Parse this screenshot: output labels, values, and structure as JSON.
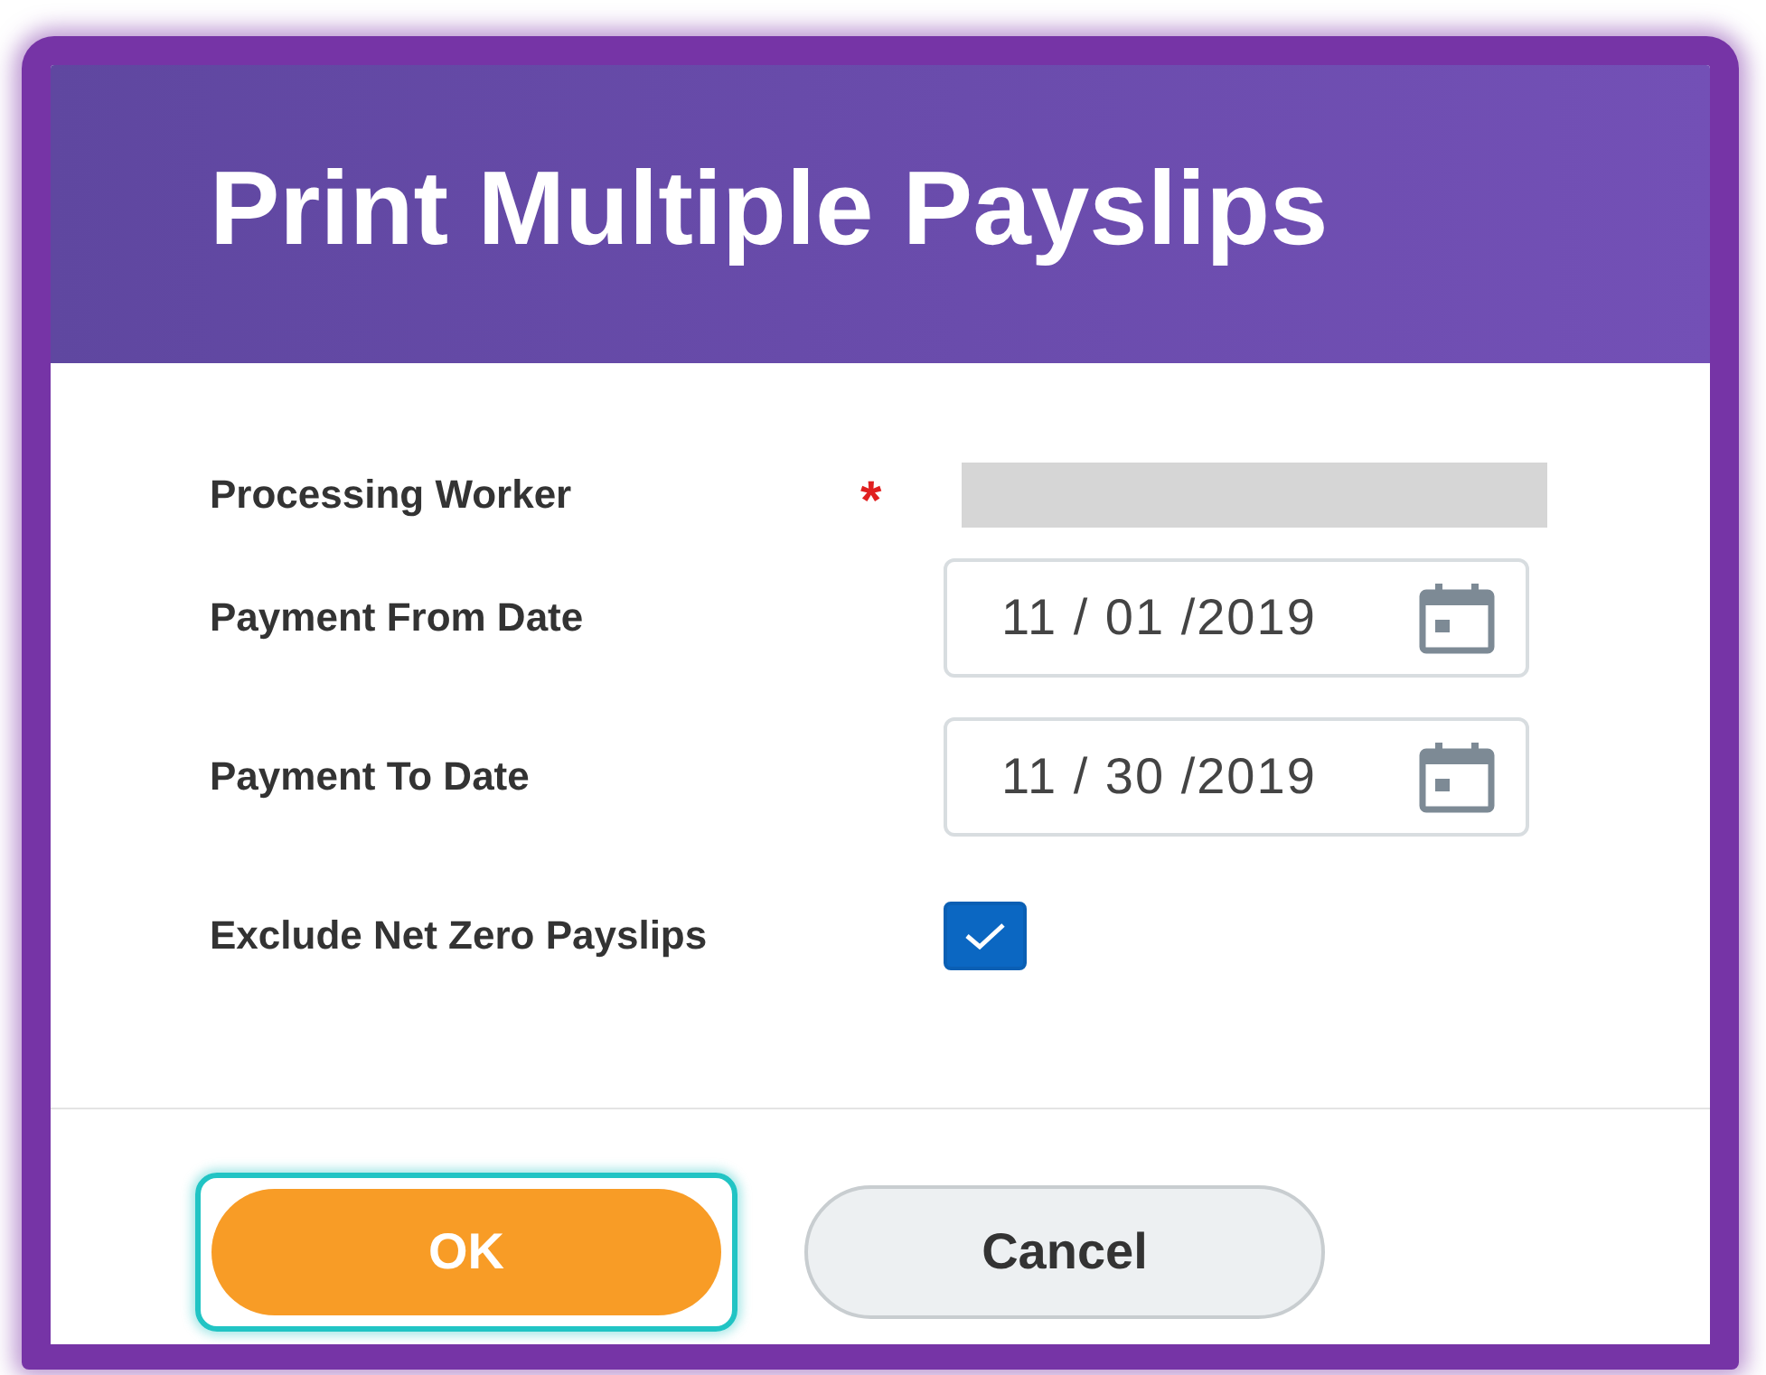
{
  "dialog": {
    "title": "Print Multiple Payslips"
  },
  "fields": [
    {
      "kind": "text",
      "label": "Processing Worker",
      "required_mark": "*"
    },
    {
      "kind": "date",
      "label": "Payment From Date",
      "value": "11 / 01 /2019"
    },
    {
      "kind": "date",
      "label": "Payment To Date",
      "value": "11 / 30 /2019"
    },
    {
      "kind": "checkbox",
      "label": "Exclude Net Zero Payslips",
      "checked": true
    }
  ],
  "buttons": [
    {
      "kind": "primary",
      "label": "OK",
      "focused": true
    },
    {
      "kind": "secondary",
      "label": "Cancel",
      "focused": false
    }
  ]
}
